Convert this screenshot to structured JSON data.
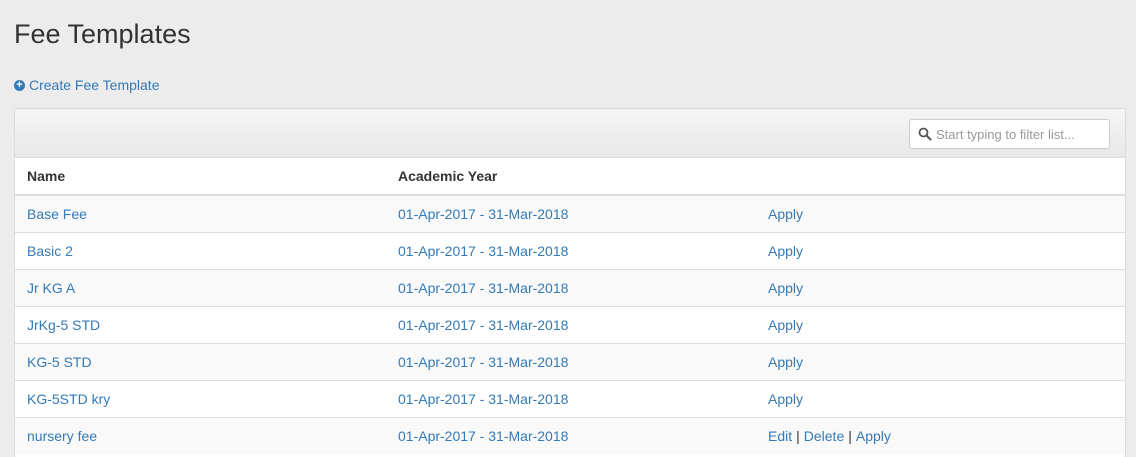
{
  "page": {
    "title": "Fee Templates"
  },
  "actions": {
    "create_label": "Create Fee Template"
  },
  "search": {
    "placeholder": "Start typing to filter list..."
  },
  "table": {
    "headers": {
      "name": "Name",
      "academic_year": "Academic Year",
      "actions": ""
    },
    "rows": [
      {
        "name": "Base Fee",
        "academic_year": "01-Apr-2017 - 31-Mar-2018",
        "edit": "",
        "delete": "",
        "apply": "Apply"
      },
      {
        "name": "Basic 2",
        "academic_year": "01-Apr-2017 - 31-Mar-2018",
        "edit": "",
        "delete": "",
        "apply": "Apply"
      },
      {
        "name": "Jr KG A",
        "academic_year": "01-Apr-2017 - 31-Mar-2018",
        "edit": "",
        "delete": "",
        "apply": "Apply"
      },
      {
        "name": "JrKg-5 STD",
        "academic_year": "01-Apr-2017 - 31-Mar-2018",
        "edit": "",
        "delete": "",
        "apply": "Apply"
      },
      {
        "name": "KG-5 STD",
        "academic_year": "01-Apr-2017 - 31-Mar-2018",
        "edit": "",
        "delete": "",
        "apply": "Apply"
      },
      {
        "name": "KG-5STD kry",
        "academic_year": "01-Apr-2017 - 31-Mar-2018",
        "edit": "",
        "delete": "",
        "apply": "Apply"
      },
      {
        "name": "nursery fee",
        "academic_year": "01-Apr-2017 - 31-Mar-2018",
        "edit": "Edit",
        "delete": "Delete",
        "apply": "Apply"
      }
    ]
  },
  "colors": {
    "link": "#337ab7",
    "background": "#ececec",
    "row_stripe": "#f9f9f9"
  }
}
